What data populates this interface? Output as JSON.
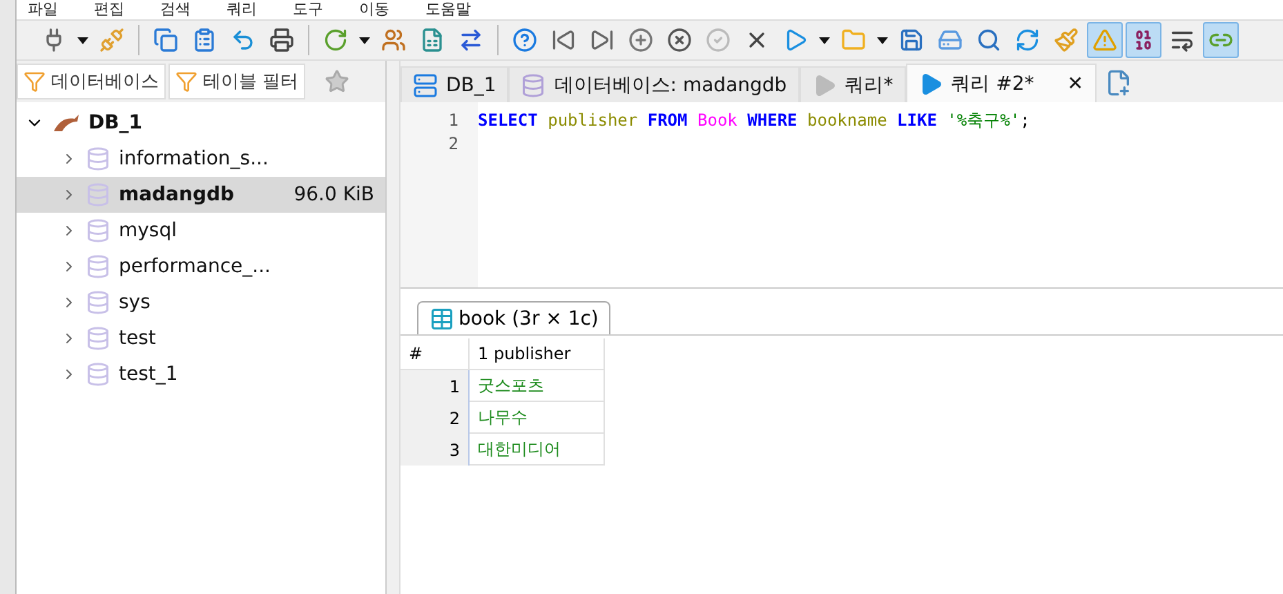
{
  "menu": [
    "파일",
    "편집",
    "검색",
    "쿼리",
    "도구",
    "이동",
    "도움말"
  ],
  "toolbar": [
    {
      "kind": "plug",
      "pressed": false
    },
    {
      "kind": "caret"
    },
    {
      "kind": "unplug",
      "pressed": false
    },
    {
      "kind": "sep"
    },
    {
      "kind": "copy",
      "pressed": false
    },
    {
      "kind": "paste",
      "pressed": false
    },
    {
      "kind": "undo",
      "pressed": false
    },
    {
      "kind": "print",
      "pressed": false
    },
    {
      "kind": "sep"
    },
    {
      "kind": "refresh",
      "pressed": false
    },
    {
      "kind": "caret"
    },
    {
      "kind": "users",
      "pressed": false
    },
    {
      "kind": "csv",
      "pressed": false
    },
    {
      "kind": "transfer",
      "pressed": false
    },
    {
      "kind": "sep"
    },
    {
      "kind": "help",
      "pressed": false
    },
    {
      "kind": "first",
      "pressed": false
    },
    {
      "kind": "last",
      "pressed": false
    },
    {
      "kind": "add",
      "pressed": false
    },
    {
      "kind": "cancel",
      "pressed": false
    },
    {
      "kind": "ok",
      "pressed": false
    },
    {
      "kind": "close",
      "pressed": false
    },
    {
      "kind": "run",
      "pressed": false
    },
    {
      "kind": "caret"
    },
    {
      "kind": "folder",
      "pressed": false
    },
    {
      "kind": "caret"
    },
    {
      "kind": "save",
      "pressed": false
    },
    {
      "kind": "save-snippet",
      "pressed": false
    },
    {
      "kind": "find",
      "pressed": false
    },
    {
      "kind": "replace",
      "pressed": false
    },
    {
      "kind": "clean",
      "pressed": false
    },
    {
      "kind": "warning",
      "pressed": true
    },
    {
      "kind": "binary",
      "pressed": true
    },
    {
      "kind": "wrap",
      "pressed": false
    },
    {
      "kind": "link",
      "pressed": true
    }
  ],
  "filter_tabs": [
    {
      "label": "데이터베이스"
    },
    {
      "label": "테이블 필터"
    }
  ],
  "tree": {
    "label": "DB_1",
    "expanded": true,
    "children": [
      {
        "label": "information_s...",
        "selected": false
      },
      {
        "label": "madangdb",
        "selected": true,
        "size": "96.0 KiB"
      },
      {
        "label": "mysql",
        "selected": false
      },
      {
        "label": "performance_...",
        "selected": false
      },
      {
        "label": "sys",
        "selected": false
      },
      {
        "label": "test",
        "selected": false
      },
      {
        "label": "test_1",
        "selected": false
      }
    ]
  },
  "tabs": [
    {
      "kind": "host",
      "label": "DB_1",
      "selected": false
    },
    {
      "kind": "database",
      "label": "데이터베이스: madangdb",
      "selected": false
    },
    {
      "kind": "query",
      "label": "쿼리*",
      "selected": false
    },
    {
      "kind": "query",
      "label": "쿼리 #2*",
      "selected": true,
      "close": "✕"
    }
  ],
  "editor": {
    "line_numbers": [
      "1",
      "2"
    ],
    "tokens": [
      {
        "kind": "keyword",
        "text": "SELECT"
      },
      {
        "kind": "ident",
        "text": "publisher"
      },
      {
        "kind": "keyword",
        "text": "FROM"
      },
      {
        "kind": "table",
        "text": "Book"
      },
      {
        "kind": "keyword",
        "text": "WHERE"
      },
      {
        "kind": "ident",
        "text": "bookname"
      },
      {
        "kind": "keyword",
        "text": "LIKE"
      },
      {
        "kind": "string",
        "text": "'%축구%'"
      },
      {
        "kind": "punct",
        "text": ";"
      }
    ]
  },
  "result_tab": {
    "label": "book (3r × 1c)"
  },
  "grid": {
    "columns": [
      "#",
      "1 publisher"
    ],
    "rows": [
      {
        "num": "1",
        "publisher": "굿스포츠"
      },
      {
        "num": "2",
        "publisher": "나무수"
      },
      {
        "num": "3",
        "publisher": "대한미디어"
      }
    ]
  }
}
